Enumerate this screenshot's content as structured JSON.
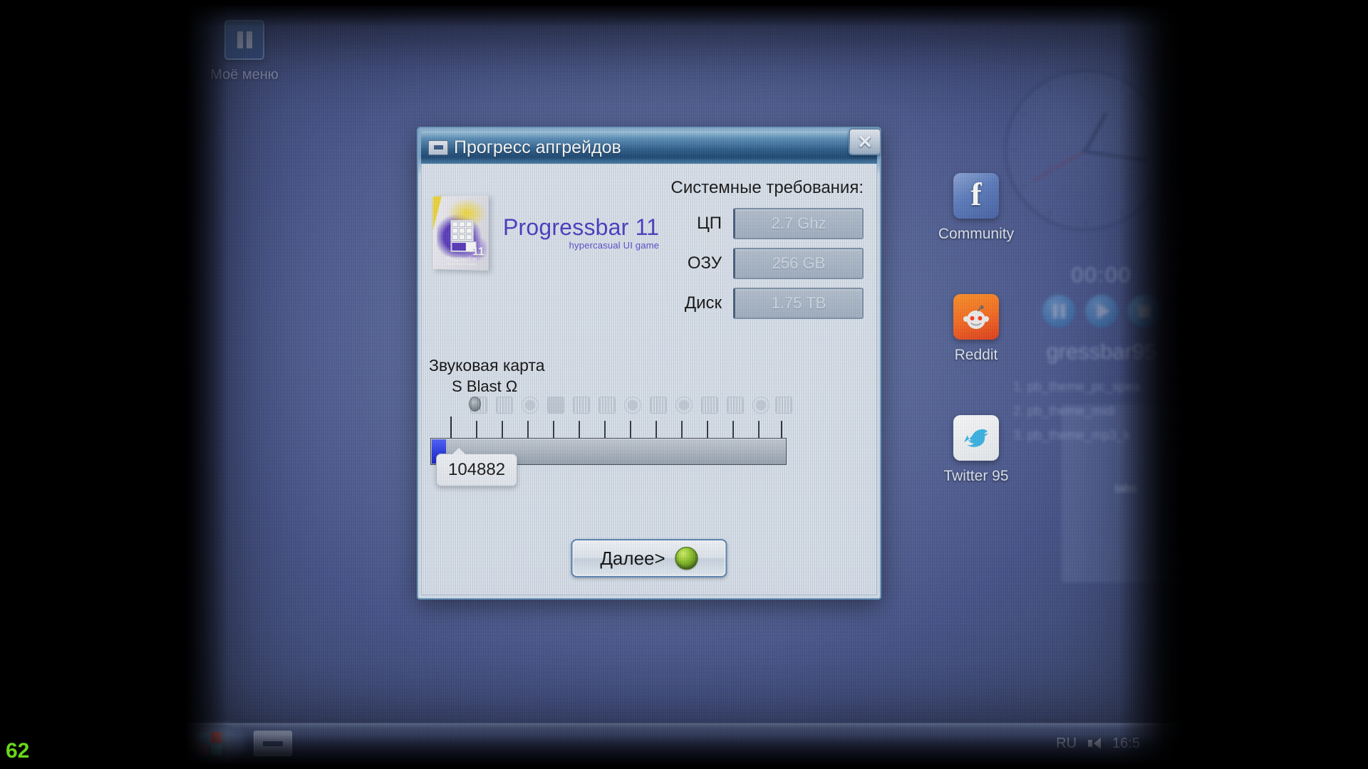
{
  "desktop": {
    "icons": [
      {
        "name": "my-menu",
        "label": "Моё меню"
      },
      {
        "name": "community",
        "label": "Community"
      },
      {
        "name": "reddit",
        "label": "Reddit"
      },
      {
        "name": "twitter",
        "label": "Twitter 95"
      }
    ]
  },
  "widgets": {
    "player": {
      "time": "00:00",
      "title": "gressbar95",
      "tracks": [
        "1. pb_theme_pc_spea",
        "2. pb_theme_midi",
        "3. pb_theme_mp3_k"
      ]
    },
    "side_panel_text": "tabs"
  },
  "taskbar": {
    "language": "RU",
    "clock": "16:5"
  },
  "fps": "62",
  "dialog": {
    "title": "Прогресс апгрейдов",
    "close_label": "✕",
    "product": {
      "logo_main": "Progressbar 11",
      "logo_sub": "hypercasual UI game",
      "box_title": "Progressbar",
      "box_sub": "hypercasual UI game",
      "box_number": "11"
    },
    "requirements": {
      "title": "Системные требования:",
      "rows": [
        {
          "label": "ЦП",
          "value": "2.7 Ghz"
        },
        {
          "label": "ОЗУ",
          "value": "256 GB"
        },
        {
          "label": "Диск",
          "value": "1.75 TB"
        }
      ]
    },
    "sound": {
      "section_label": "Звуковая карта",
      "device_name": "S Blast Ω"
    },
    "progress": {
      "tooltip_value": "104882",
      "fill_percent": 4
    },
    "next_button": {
      "label": "Далее>"
    }
  }
}
